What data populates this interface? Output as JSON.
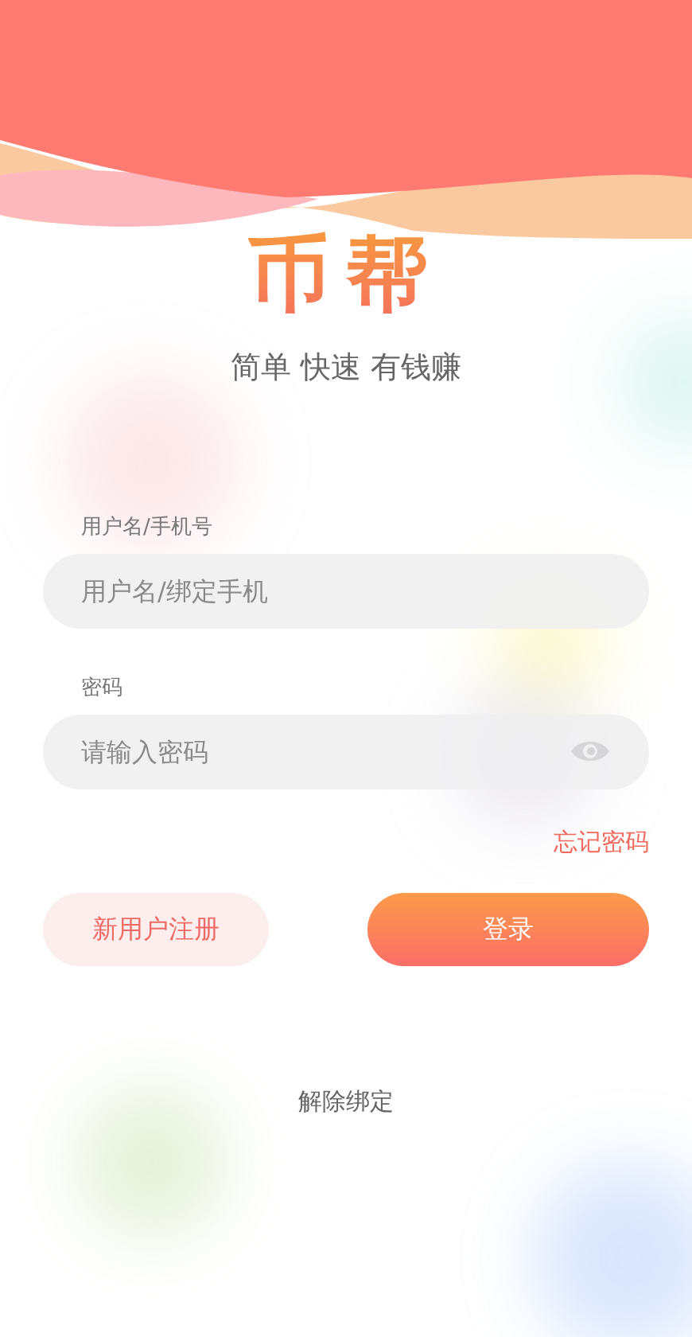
{
  "logo": "币帮",
  "tagline": "简单 快速 有钱赚",
  "fields": [
    {
      "label": "用户名/手机号",
      "placeholder": "用户名/绑定手机",
      "kind": "text"
    },
    {
      "label": "密码",
      "placeholder": "请输入密码",
      "kind": "password"
    }
  ],
  "forgot_password": "忘记密码",
  "buttons": [
    {
      "label": "新用户注册",
      "kind": "secondary"
    },
    {
      "label": "登录",
      "kind": "primary"
    }
  ],
  "unbind": "解除绑定"
}
